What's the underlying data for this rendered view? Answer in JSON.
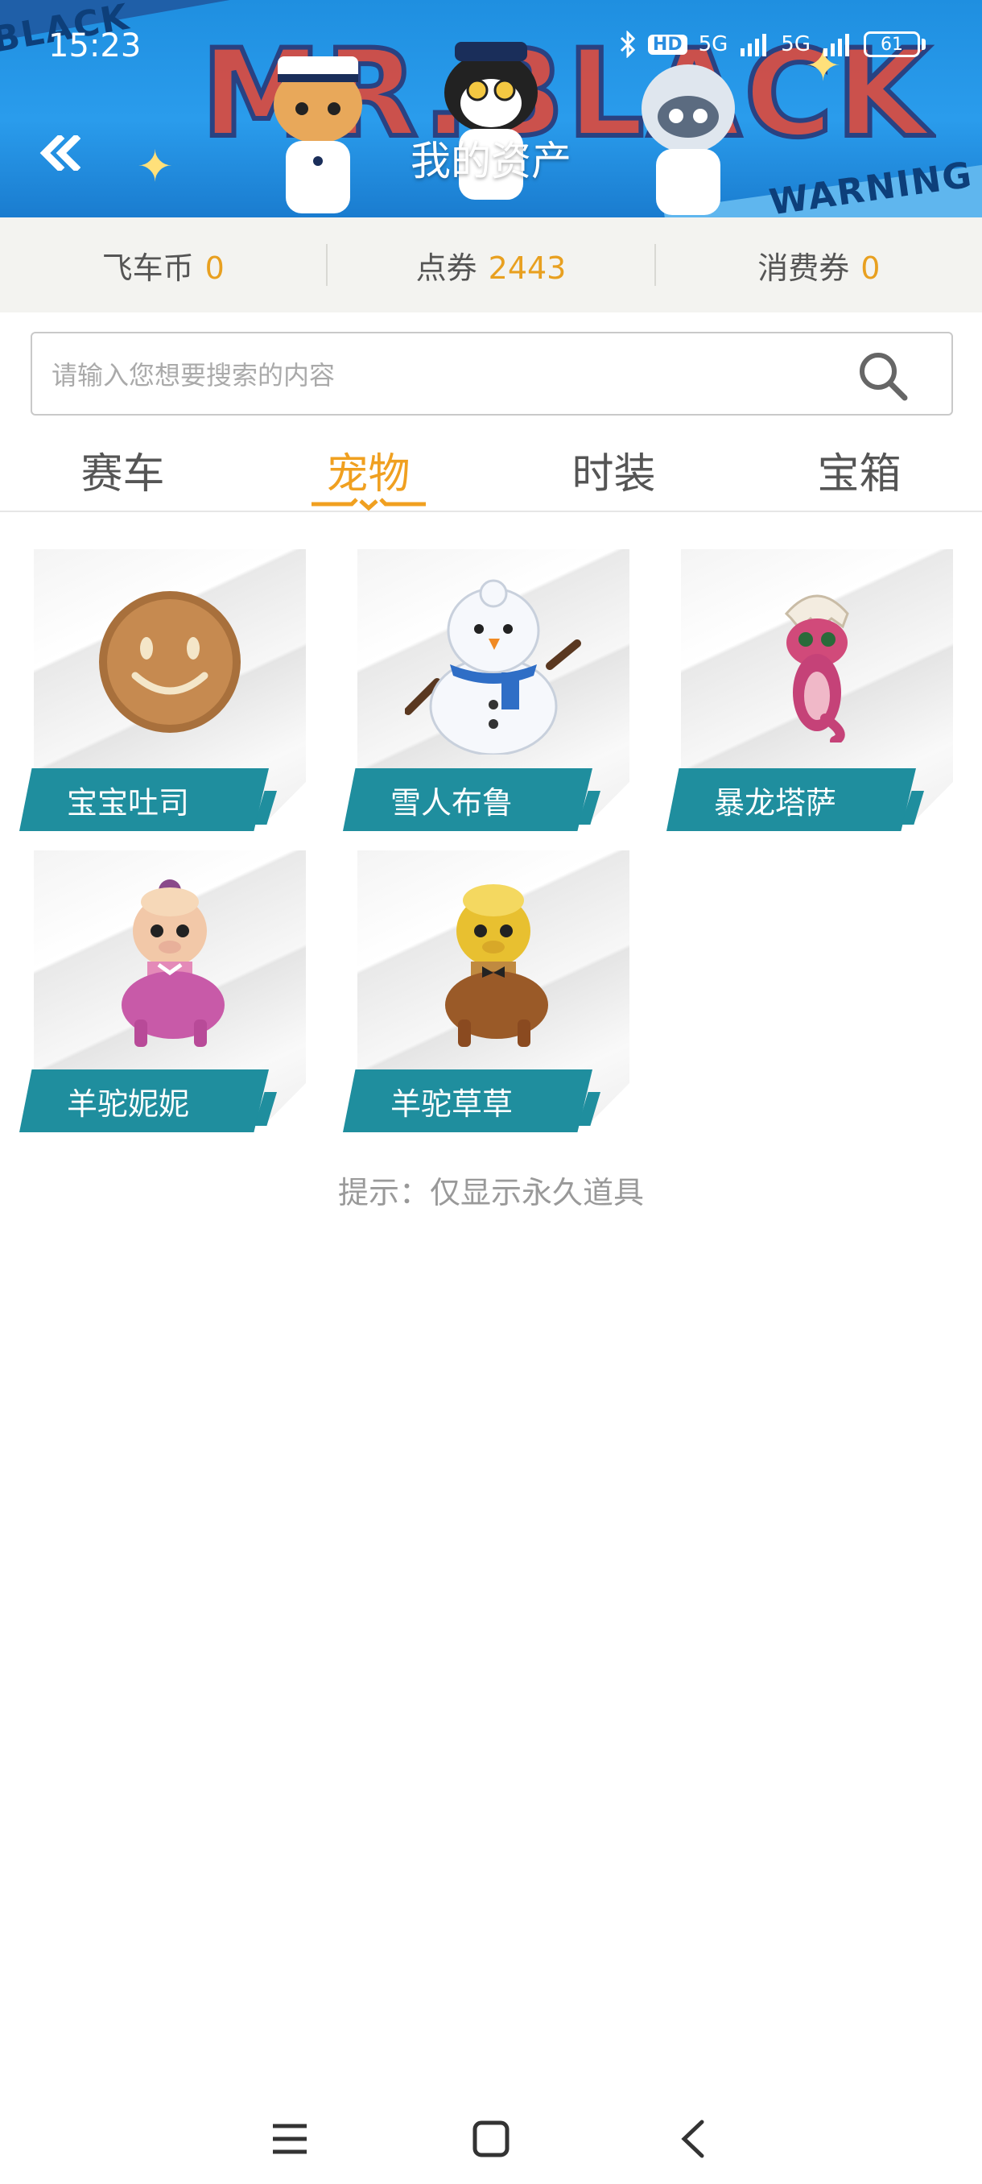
{
  "status_bar": {
    "time": "15:23",
    "network_5g_a": "5G",
    "network_5g_b": "5G",
    "hd_badge": "HD",
    "battery": "61",
    "icons": [
      "bluetooth-icon",
      "hd-icon",
      "signal-icon",
      "signal-icon",
      "battery-icon"
    ]
  },
  "header": {
    "title": "我的资产",
    "banner_text": "MR.BLACK",
    "banner_side_text": "WARNING",
    "banner_left_text": "BLACK",
    "back_icon": "double-chevron-left-icon"
  },
  "balances": [
    {
      "label": "飞车币",
      "value": "0"
    },
    {
      "label": "点券",
      "value": "2443"
    },
    {
      "label": "消费券",
      "value": "0"
    }
  ],
  "search": {
    "placeholder": "请输入您想要搜索的内容",
    "icon": "search-icon"
  },
  "tabs": [
    {
      "label": "赛车",
      "active": false
    },
    {
      "label": "宠物",
      "active": true
    },
    {
      "label": "时装",
      "active": false
    },
    {
      "label": "宝箱",
      "active": false
    }
  ],
  "pets": [
    {
      "name": "宝宝吐司",
      "icon": "toast-face-icon"
    },
    {
      "name": "雪人布鲁",
      "icon": "snowman-icon"
    },
    {
      "name": "暴龙塔萨",
      "icon": "baby-dragon-icon"
    },
    {
      "name": "羊驼妮妮",
      "icon": "pink-alpaca-icon"
    },
    {
      "name": "羊驼草草",
      "icon": "yellow-alpaca-icon"
    }
  ],
  "hint": "提示：仅显示永久道具",
  "colors": {
    "header_blue": "#2a9cec",
    "accent_orange": "#f0a020",
    "label_teal": "#1f8e9e"
  },
  "nav": {
    "icons": [
      "menu-icon",
      "home-icon",
      "back-icon"
    ]
  }
}
